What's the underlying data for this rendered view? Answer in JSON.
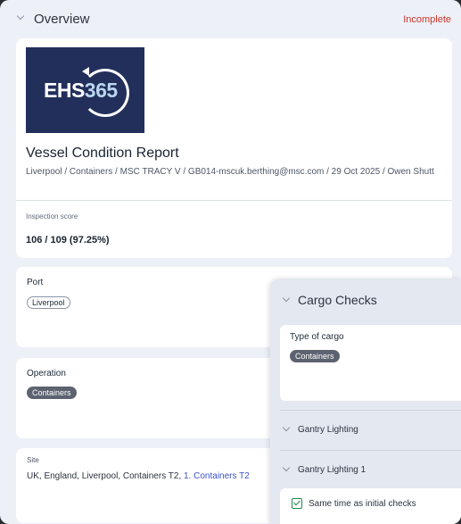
{
  "overview": {
    "title": "Overview",
    "status": "Incomplete",
    "colors": {
      "status": "#d0342c",
      "accent": "#232f5b",
      "link": "#3a54c8",
      "check": "#1f8a4c"
    }
  },
  "logo": {
    "brand": "EHS",
    "number": "365"
  },
  "report": {
    "title": "Vessel Condition Report",
    "breadcrumb": "Liverpool / Containers / MSC TRACY V / GB014-mscuk.berthing@msc.com / 29 Oct 2025 / Owen Shutt"
  },
  "inspection": {
    "label": "Inspection score",
    "value": "106 / 109 (97.25%)"
  },
  "port": {
    "label": "Port",
    "value": "Liverpool"
  },
  "operation": {
    "label": "Operation",
    "value": "Containers"
  },
  "site": {
    "label": "Site",
    "value": "UK, England, Liverpool, Containers T2,",
    "link": "1. Containers T2"
  },
  "cargo_checks": {
    "title": "Cargo Checks",
    "type_label": "Type of cargo",
    "type_value": "Containers",
    "rows": [
      "Gantry Lighting",
      "Gantry Lighting 1"
    ],
    "checkbox_label": "Same time as initial checks",
    "checkbox_checked": true
  }
}
